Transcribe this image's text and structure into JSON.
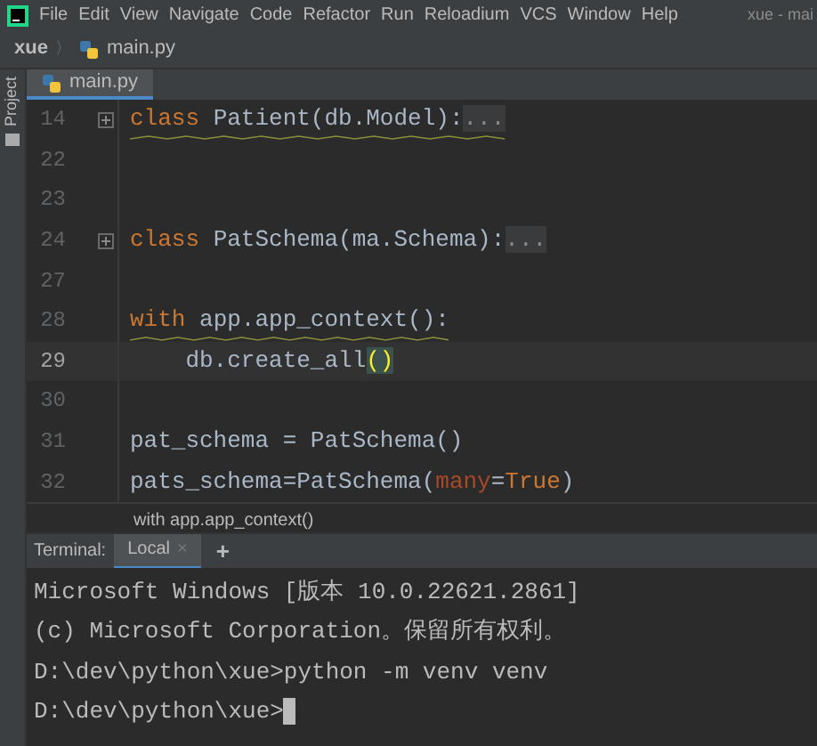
{
  "menu": {
    "items": [
      "File",
      "Edit",
      "View",
      "Navigate",
      "Code",
      "Refactor",
      "Run",
      "Reloadium",
      "VCS",
      "Window",
      "Help"
    ],
    "window_title": "xue - mai"
  },
  "breadcrumb": {
    "project": "xue",
    "separator": "〉",
    "file": "main.py"
  },
  "side_strip": {
    "label": "Project"
  },
  "editor_tabs": [
    {
      "label": "main.py",
      "selected": true
    }
  ],
  "code_lines": [
    {
      "number": "14",
      "current": false,
      "folded": true,
      "squiggle": true,
      "tokens": [
        {
          "kind": "keyword",
          "text": "class"
        },
        {
          "kind": "plain",
          "text": " Patient(db.Model):"
        },
        {
          "kind": "fold",
          "text": "..."
        }
      ]
    },
    {
      "number": "22",
      "current": false,
      "folded": false,
      "squiggle": false
    },
    {
      "number": "23",
      "current": false,
      "folded": false,
      "squiggle": false
    },
    {
      "number": "24",
      "current": false,
      "folded": true,
      "squiggle": false,
      "tokens": [
        {
          "kind": "keyword",
          "text": "class"
        },
        {
          "kind": "plain",
          "text": " PatSchema(ma.Schema):"
        },
        {
          "kind": "fold",
          "text": "..."
        }
      ]
    },
    {
      "number": "27",
      "current": false,
      "folded": false,
      "squiggle": false
    },
    {
      "number": "28",
      "current": false,
      "folded": false,
      "squiggle": true,
      "tokens": [
        {
          "kind": "keyword",
          "text": "with"
        },
        {
          "kind": "plain",
          "text": " app.app_context():"
        }
      ]
    },
    {
      "number": "29",
      "current": true,
      "folded": false,
      "squiggle": false,
      "tokens": [
        {
          "kind": "plain",
          "text": "    db.create_all"
        },
        {
          "kind": "paren",
          "text": "()"
        }
      ]
    },
    {
      "number": "30",
      "current": false,
      "folded": false,
      "squiggle": false
    },
    {
      "number": "31",
      "current": false,
      "folded": false,
      "squiggle": false,
      "tokens": [
        {
          "kind": "plain",
          "text": "pat_schema = PatSchema()"
        }
      ]
    },
    {
      "number": "32",
      "current": false,
      "folded": false,
      "squiggle": false,
      "tokens": [
        {
          "kind": "plain",
          "text": "pats_schema=PatSchema("
        },
        {
          "kind": "param",
          "text": "many"
        },
        {
          "kind": "plain",
          "text": "="
        },
        {
          "kind": "keyword",
          "text": "True"
        },
        {
          "kind": "plain",
          "text": ")"
        }
      ]
    }
  ],
  "editor_breadcrumb": "with app.app_context()",
  "terminal": {
    "label": "Terminal:",
    "tabs": [
      {
        "label": "Local",
        "selected": true,
        "close": "×"
      }
    ],
    "add": "+",
    "lines": [
      "Microsoft Windows [版本 10.0.22621.2861]",
      "(c) Microsoft Corporation。保留所有权利。",
      "D:\\dev\\python\\xue>python -m venv venv",
      "D:\\dev\\python\\xue>"
    ]
  }
}
